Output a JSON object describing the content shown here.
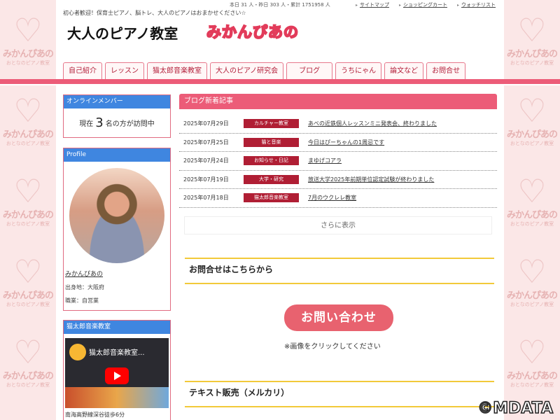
{
  "background": {
    "watermark_line1": "みかんぴあの",
    "watermark_line2": "おとなのピアノ教室"
  },
  "topbar": {
    "counter": "本日 31 人・昨日 303 人・累計 1751958 人",
    "links": [
      "サイトマップ",
      "ショッピングカート",
      "ウォッチリスト"
    ]
  },
  "header": {
    "tagline": "初心者歓迎！保育士ピアノ、脳トレ、大人のピアノはおまかせください☆",
    "logo_main": "大人のピアノ教室",
    "logo_sub": "みかんぴあの"
  },
  "nav": {
    "tabs": [
      "自己紹介",
      "レッスン",
      "猫太郎音楽教室",
      "大人のピアノ研究会",
      "ブログ",
      "うちにゃん",
      "論文など",
      "お問合せ"
    ]
  },
  "sidebar": {
    "online": {
      "title": "オンラインメンバー",
      "prefix": "現在",
      "count": "3",
      "suffix": "名の方が訪問中"
    },
    "profile": {
      "title": "Profile",
      "name": "みかんぴあの",
      "birthplace": "出身地：大阪府",
      "job": "職業：自営業"
    },
    "school": {
      "title": "猫太郎音楽教室",
      "video_title": "猫太郎音楽教室...",
      "footer": "南海高野線深谷徒歩6分"
    }
  },
  "blog": {
    "title": "ブログ新着記事",
    "posts": [
      {
        "date": "2025年07月29日",
        "category": "カルチャー教室",
        "title": "あべの近鉄個人レッスンミニ発表会、終わりました"
      },
      {
        "date": "2025年07月25日",
        "category": "猫と音楽",
        "title": "今日はぴーちゃんの1周忌です"
      },
      {
        "date": "2025年07月24日",
        "category": "お知らせ・日記",
        "title": "まゆげコアラ"
      },
      {
        "date": "2025年07月19日",
        "category": "大学・研究",
        "title": "放送大学2025年前期単位認定試験が終わりました"
      },
      {
        "date": "2025年07月18日",
        "category": "猫太郎音楽教室",
        "title": "7月のウクレレ教室"
      }
    ],
    "more": "さらに表示"
  },
  "contact": {
    "heading": "お問合せはこちらから",
    "button": "お問い合わせ",
    "note": "※画像をクリックしてください"
  },
  "text_sales": {
    "heading": "テキスト販売（メルカリ）"
  },
  "copyright": "©MDATA",
  "colors": {
    "accent": "#ec5c78",
    "side_header": "#3f86e0",
    "category_bg": "#b01e34",
    "section_rule": "#f2c93a"
  }
}
